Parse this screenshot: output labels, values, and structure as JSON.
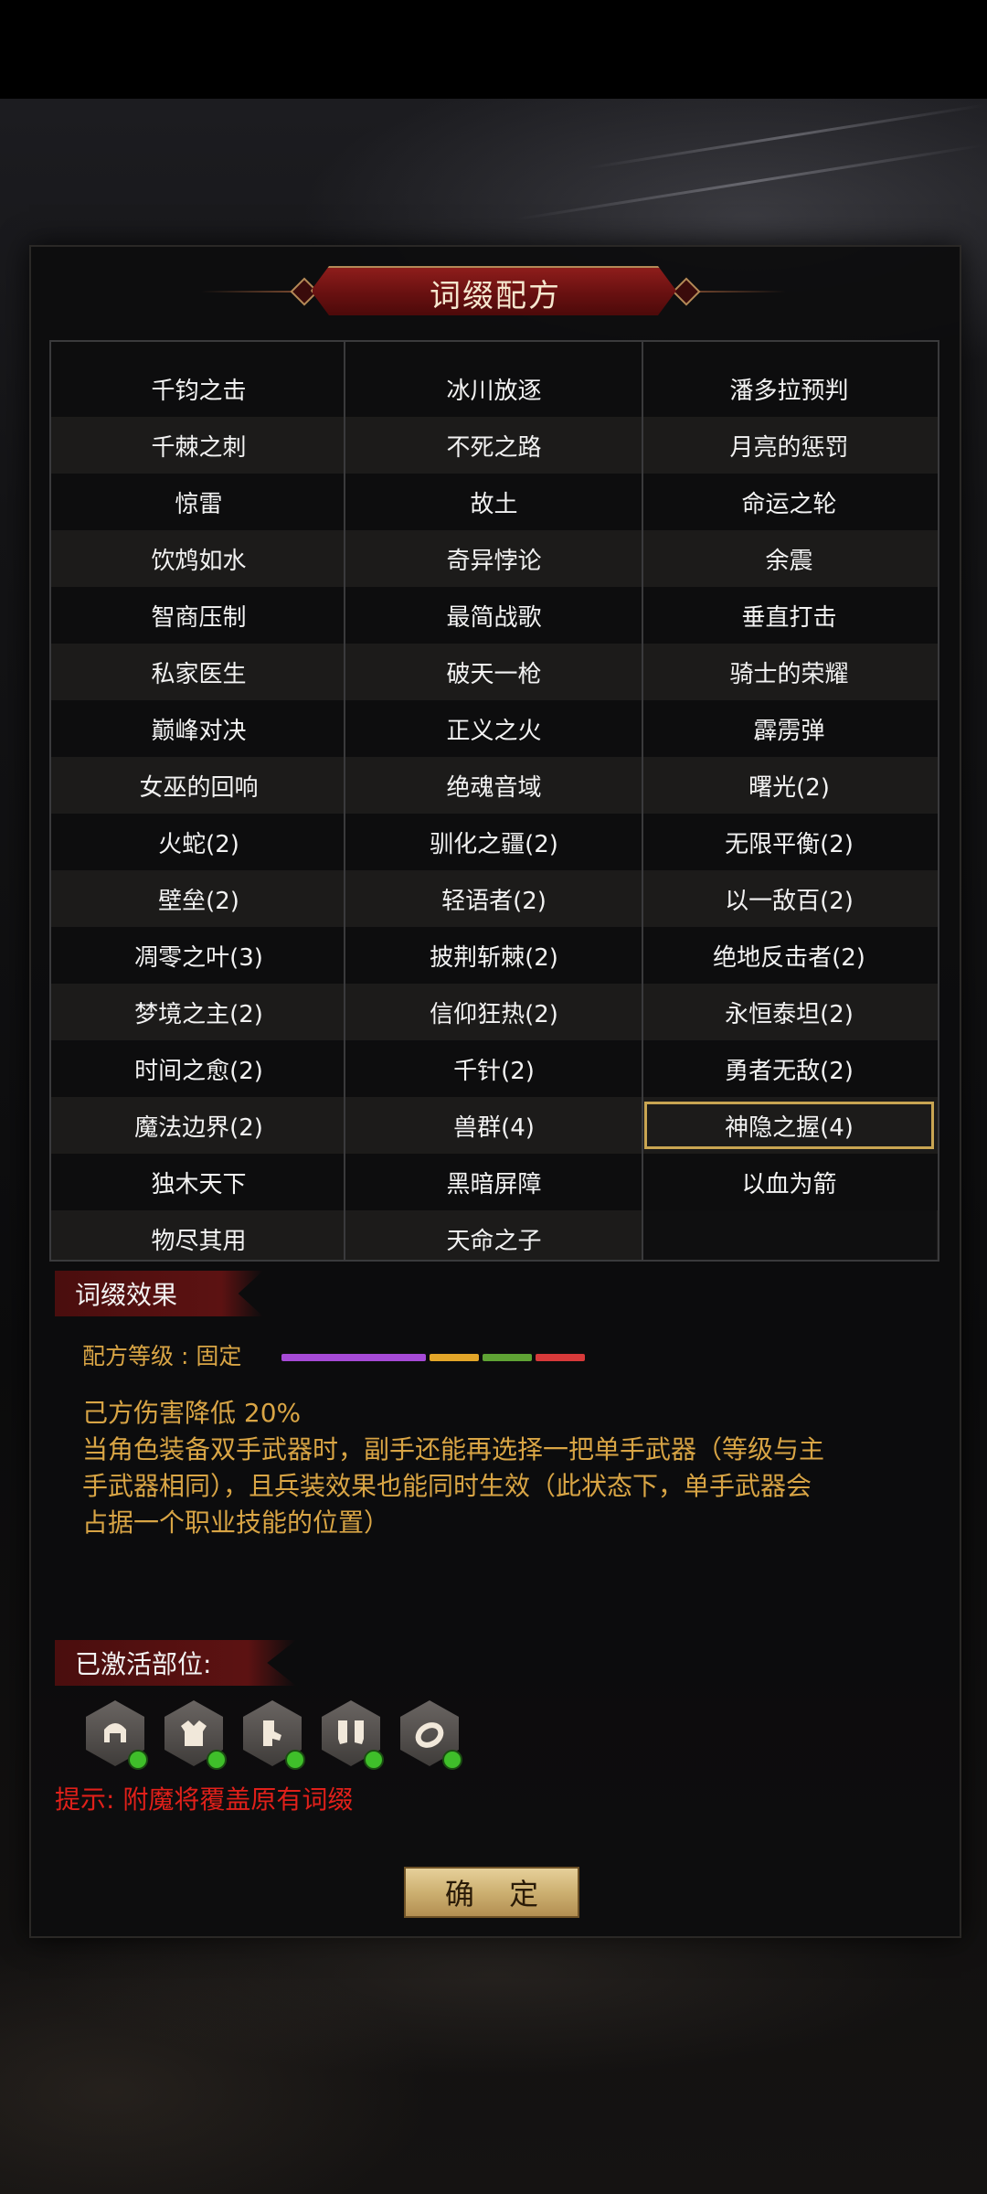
{
  "header": {
    "title": "词缀配方"
  },
  "recipes": {
    "partial_row": [
      "",
      "",
      ""
    ],
    "rows": [
      [
        "千钧之击",
        "冰川放逐",
        "潘多拉预判"
      ],
      [
        "千棘之刺",
        "不死之路",
        "月亮的惩罚"
      ],
      [
        "惊雷",
        "故土",
        "命运之轮"
      ],
      [
        "饮鸩如水",
        "奇异悖论",
        "余震"
      ],
      [
        "智商压制",
        "最简战歌",
        "垂直打击"
      ],
      [
        "私家医生",
        "破天一枪",
        "骑士的荣耀"
      ],
      [
        "巅峰对决",
        "正义之火",
        "霹雳弹"
      ],
      [
        "女巫的回响",
        "绝魂音域",
        "曙光(2)"
      ],
      [
        "火蛇(2)",
        "驯化之疆(2)",
        "无限平衡(2)"
      ],
      [
        "壁垒(2)",
        "轻语者(2)",
        "以一敌百(2)"
      ],
      [
        "凋零之叶(3)",
        "披荆斩棘(2)",
        "绝地反击者(2)"
      ],
      [
        "梦境之主(2)",
        "信仰狂热(2)",
        "永恒泰坦(2)"
      ],
      [
        "时间之愈(2)",
        "千针(2)",
        "勇者无敌(2)"
      ],
      [
        "魔法边界(2)",
        "兽群(4)",
        "神隐之握(4)"
      ],
      [
        "独木天下",
        "黑暗屏障",
        "以血为箭"
      ],
      [
        "物尽其用",
        "天命之子",
        ""
      ]
    ],
    "selected": "神隐之握(4)"
  },
  "effect": {
    "section_label": "词缀效果",
    "level_label": "配方等级 : 固定",
    "level_colors": [
      "#a64ad6",
      "#e3a629",
      "#5fa334",
      "#d83a3a"
    ],
    "lines": [
      "己方伤害降低 20%",
      "当角色装备双手武器时，副手还能再选择一把单手武器（等级与主",
      "手武器相同），且兵装效果也能同时生效（此状态下，单手武器会",
      "占据一个职业技能的位置）"
    ]
  },
  "slots": {
    "section_label": "已激活部位:",
    "items": [
      "helmet-icon",
      "armor-icon",
      "glove-icon",
      "boots-icon",
      "ring-icon"
    ],
    "status_color": "#3fbf2a"
  },
  "hint": "提示: 附魔将覆盖原有词缀",
  "confirm_label": "确 定"
}
